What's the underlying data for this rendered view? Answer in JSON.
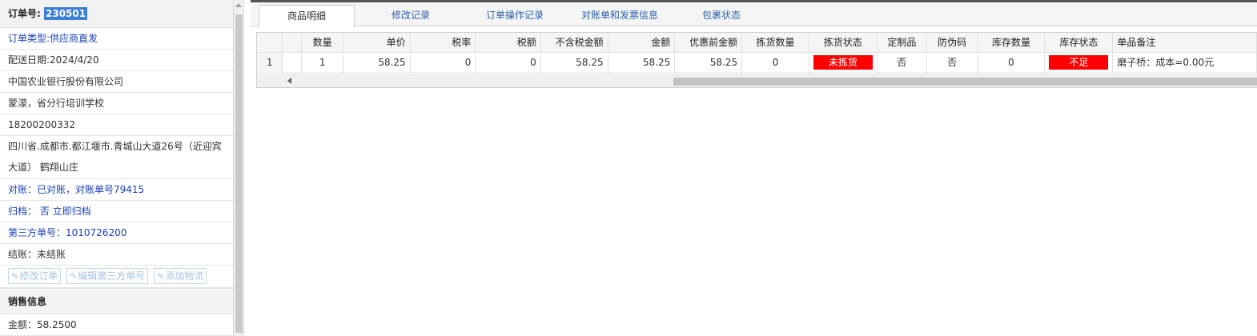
{
  "order": {
    "label": "订单号:",
    "number": "230501"
  },
  "info": {
    "order_type": "订单类型:供应商直发",
    "delivery_date": "配送日期:2024/4/20",
    "company": "中国农业银行股份有限公司",
    "contact": "蒙濛，省分行培训学校",
    "phone": "18200200332",
    "address": "四川省.成都市.都江堰市.青城山大道26号（近迎宾大道） 鹤翔山庄",
    "reconcile": "对账：已对账，对账单号79415",
    "archive": "归档： 否 立即归档",
    "third_party": "第三方单号：1010726200",
    "settle": "结账：未结账"
  },
  "buttons": {
    "edit_order": "修改订单",
    "edit_third": "编辑第三方单号",
    "add_logistics": "添加物流"
  },
  "sales": {
    "title": "销售信息",
    "amount": "金额：58.2500"
  },
  "tabs": [
    {
      "label": "商品明细",
      "active": true
    },
    {
      "label": "修改记录",
      "active": false
    },
    {
      "label": "订单操作记录",
      "active": false
    },
    {
      "label": "对账单和发票信息",
      "active": false
    },
    {
      "label": "包裹状态",
      "active": false
    }
  ],
  "grid": {
    "headers": [
      "",
      "",
      "数量",
      "单价",
      "税率",
      "税额",
      "不含税金额",
      "金额",
      "优惠前金额",
      "拣货数量",
      "拣货状态",
      "定制品",
      "防伪码",
      "库存数量",
      "库存状态",
      "单品备注"
    ],
    "rows": [
      {
        "index": "1",
        "qty": "1",
        "price": "58.25",
        "tax_rate": "0",
        "tax": "0",
        "net_amount": "58.25",
        "amount": "58.25",
        "pre_discount": "58.25",
        "pick_qty": "0",
        "pick_status": "未拣货",
        "custom": "否",
        "anti_fake": "否",
        "stock_qty": "0",
        "stock_status": "不足",
        "remark": "磨子桥：成本=0.00元"
      }
    ]
  },
  "colors": {
    "accent": "#3b7fd8",
    "link": "#1a3fb4",
    "status_red": "#ff0000"
  }
}
